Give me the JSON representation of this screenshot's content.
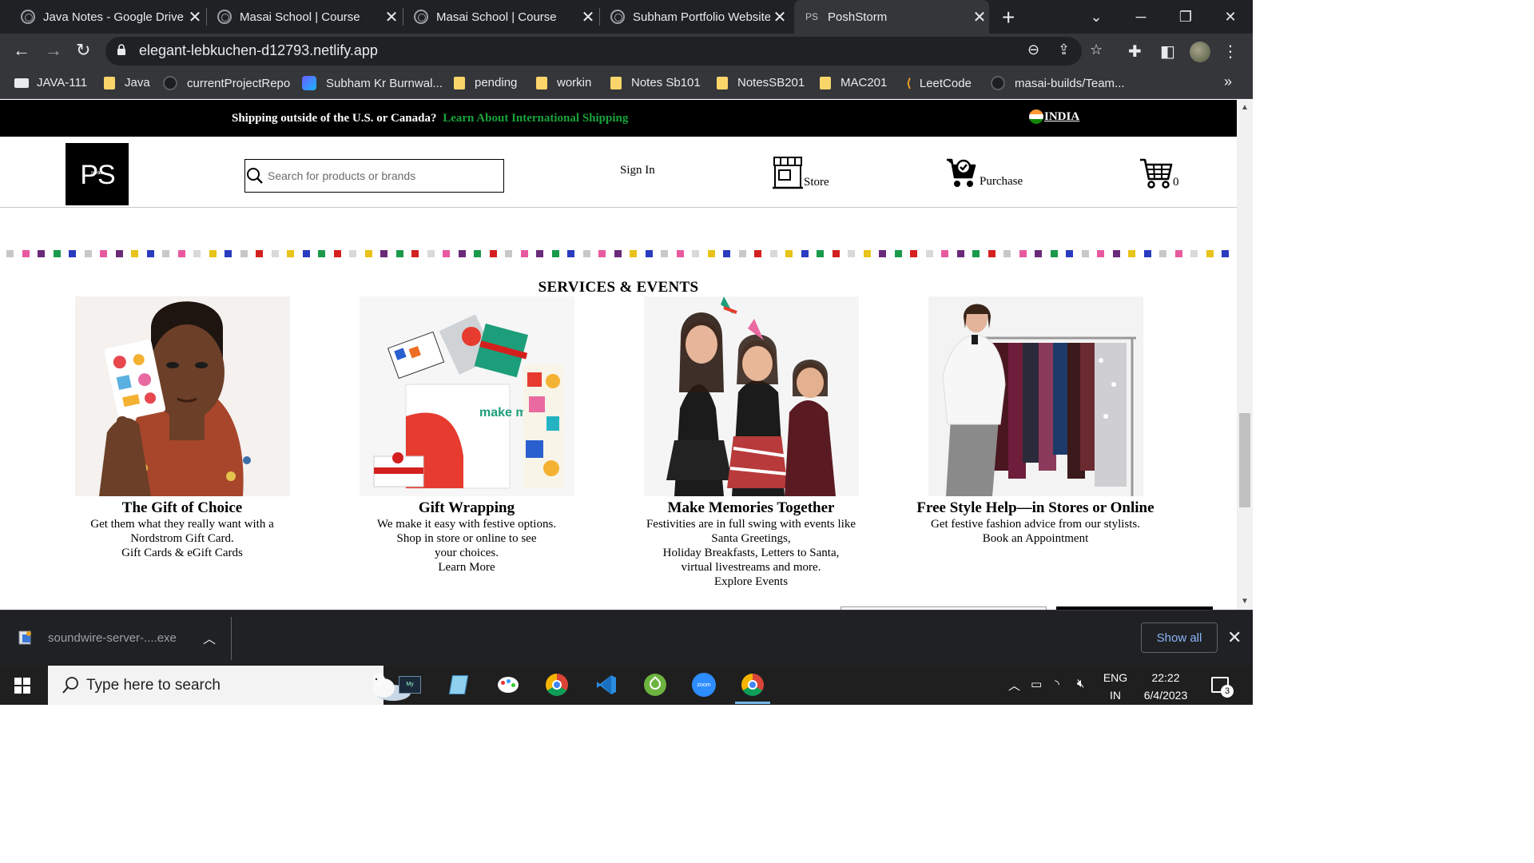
{
  "browser": {
    "tabs": [
      {
        "title": "Java Notes - Google Drive",
        "active": false
      },
      {
        "title": "Masai School | Course",
        "active": false
      },
      {
        "title": "Masai School | Course",
        "active": false
      },
      {
        "title": "Subham Portfolio Website",
        "active": false
      },
      {
        "title": "PoshStorm",
        "active": true,
        "favicon_text": "PS"
      }
    ],
    "url": "elegant-lebkuchen-d12793.netlify.app",
    "bookmarks": [
      {
        "label": "JAVA-111",
        "icon": "app-icon"
      },
      {
        "label": "Java",
        "icon": "folder-icon"
      },
      {
        "label": "currentProjectRepo",
        "icon": "github-icon"
      },
      {
        "label": "Subham Kr Burnwal...",
        "icon": "profile-icon"
      },
      {
        "label": "pending",
        "icon": "folder-icon"
      },
      {
        "label": "workin",
        "icon": "folder-icon"
      },
      {
        "label": "Notes Sb101",
        "icon": "folder-icon"
      },
      {
        "label": "NotesSB201",
        "icon": "folder-icon"
      },
      {
        "label": "MAC201",
        "icon": "folder-icon"
      },
      {
        "label": "LeetCode",
        "icon": "leetcode-icon"
      },
      {
        "label": "masai-builds/Team...",
        "icon": "github-icon"
      }
    ]
  },
  "site": {
    "shipping_text": "Shipping outside of the U.S. or Canada?",
    "shipping_link": "Learn About International Shipping",
    "country": "INDIA",
    "logo_text": "PS",
    "logo_subtext": "PoshStorm",
    "search_placeholder": "Search for products or brands",
    "sign_in": "Sign In",
    "store_label": "Store",
    "purchase_label": "Purchase",
    "cart_count": "0",
    "services_title": "SERVICES & EVENTS",
    "services": [
      {
        "title": "The Gift of Choice",
        "lines": [
          "Get them what they really want with a",
          "Nordstrom Gift Card.",
          "Gift Cards & eGift Cards"
        ]
      },
      {
        "title": "Gift Wrapping",
        "lines": [
          "We make it easy with festive options.",
          "Shop in store or online to see",
          "your choices.",
          "Learn More"
        ]
      },
      {
        "title": "Make Memories Together",
        "lines": [
          "Festivities are in full swing with events like",
          "Santa Greetings,",
          "Holiday Breakfasts, Letters to Santa,",
          "virtual livestreams and more.",
          "Explore Events"
        ]
      },
      {
        "title": "Free Style Help—in Stores or Online",
        "lines": [
          "Get festive fashion advice from our stylists.",
          "Book an Appointment"
        ]
      }
    ],
    "wrap_bag_text": "make merry",
    "dot_colors": [
      "#c8c8c8",
      "#1a9a4a",
      "#e8c31a",
      "#e85aa0",
      "#d42020",
      "#2a3bc0",
      "#6a2a7a",
      "#d9d9d9"
    ]
  },
  "download_bar": {
    "file": "soundwire-server-....exe",
    "show_all": "Show all"
  },
  "taskbar": {
    "search_placeholder": "Type here to search",
    "language_top": "ENG",
    "language_bottom": "IN",
    "time": "22:22",
    "date": "6/4/2023",
    "notification_count": "3",
    "apps": [
      "mysql-icon",
      "notepad-icon",
      "paint-icon",
      "chrome-icon",
      "vscode-icon",
      "spring-icon",
      "zoom-icon",
      "chrome-icon"
    ]
  }
}
